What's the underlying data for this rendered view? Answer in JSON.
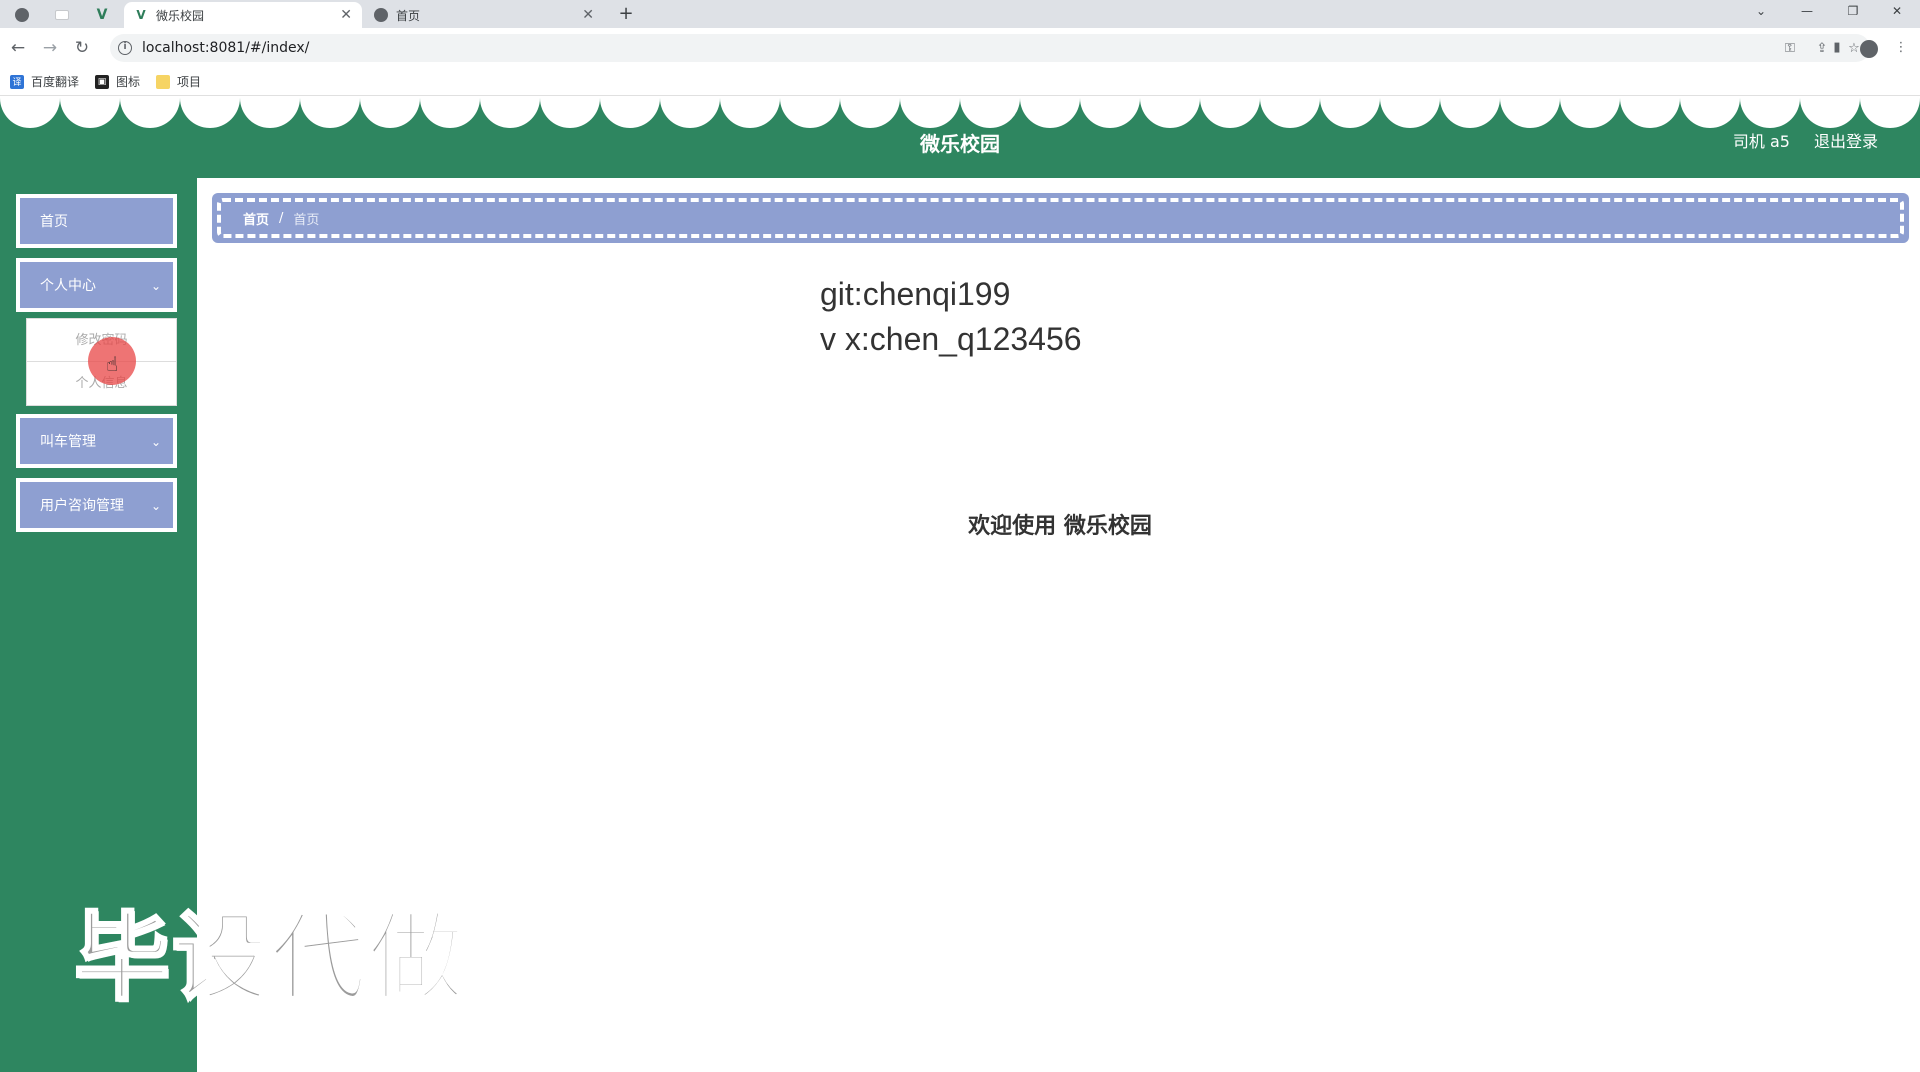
{
  "browser": {
    "tabs": [
      {
        "title": "微乐校园",
        "active": true
      },
      {
        "title": "首页",
        "active": false
      }
    ],
    "new_tab_label": "+",
    "address": "localhost:8081/#/index/",
    "bookmarks": [
      {
        "label": "百度翻译",
        "icon": "translate-icon"
      },
      {
        "label": "图标",
        "icon": "image-icon"
      },
      {
        "label": "项目",
        "icon": "folder-icon"
      }
    ]
  },
  "header": {
    "title": "微乐校园",
    "user": "司机 a5",
    "logout": "退出登录",
    "colors": {
      "primary": "#2e8660",
      "accent": "#8e9fd1"
    }
  },
  "sidebar": {
    "items": [
      {
        "label": "首页"
      },
      {
        "label": "个人中心",
        "expanded": true,
        "children": [
          {
            "label": "修改密码"
          },
          {
            "label": "个人信息"
          }
        ]
      },
      {
        "label": "叫车管理"
      },
      {
        "label": "用户咨询管理"
      }
    ]
  },
  "breadcrumb": {
    "home": "首页",
    "separator": "/",
    "current": "首页"
  },
  "main": {
    "credit_line_1": "git:chenqi199",
    "credit_line_2": "v x:chen_q123456",
    "welcome": "欢迎使用 微乐校园"
  },
  "watermark": "毕设代做"
}
